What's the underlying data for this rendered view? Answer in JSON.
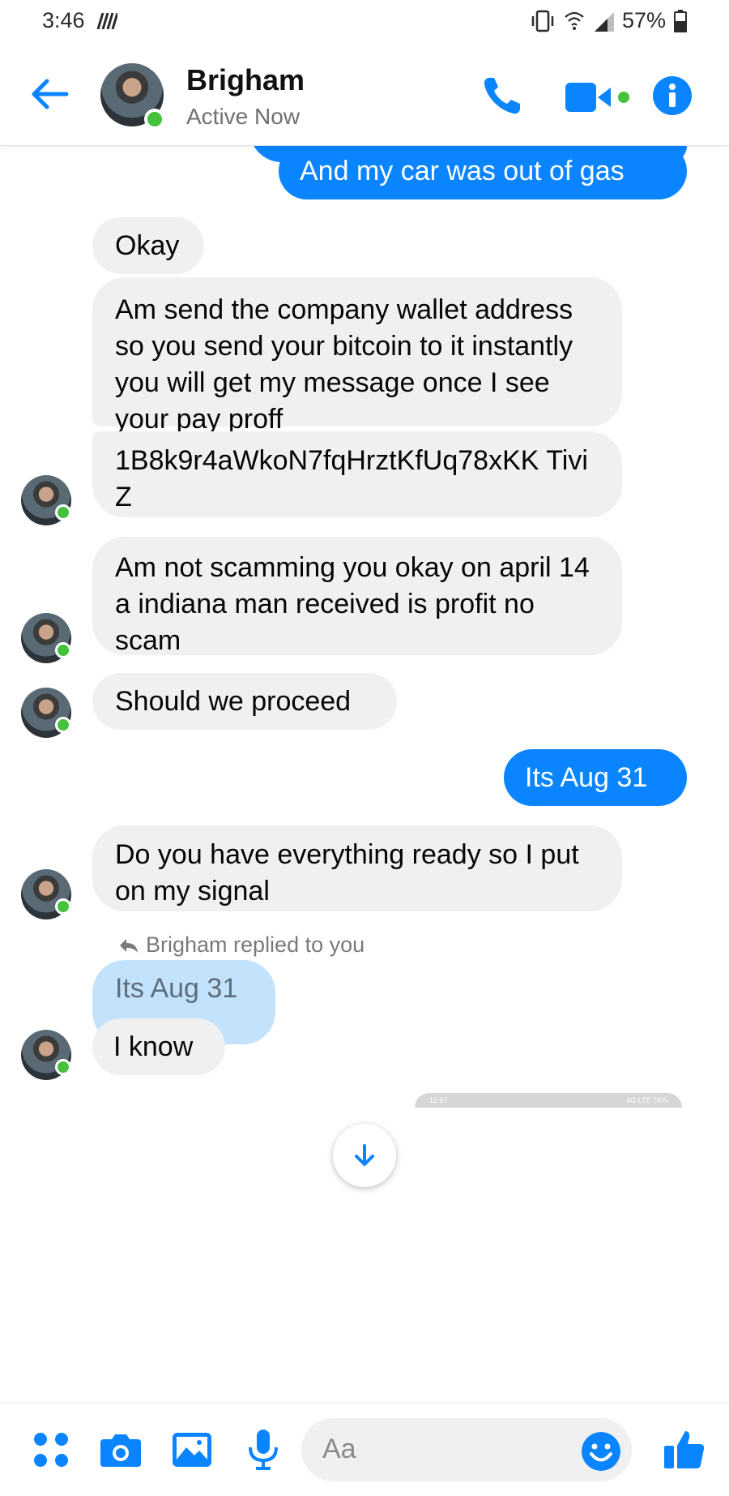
{
  "status_bar": {
    "time": "3:46",
    "battery": "57%"
  },
  "header": {
    "name": "Brigham",
    "status": "Active Now"
  },
  "messages": [
    {
      "side": "out",
      "text": "And my car was out of gas"
    },
    {
      "side": "in",
      "text": "Okay"
    },
    {
      "side": "in",
      "text": "Am send the company wallet address so you send your bitcoin to it instantly you will get my message once I see your pay proff"
    },
    {
      "side": "in",
      "text": "1B8k9r4aWkoN7fqHrztKfUq78xKK TiviZ"
    },
    {
      "side": "in",
      "text": "Am not scamming you okay on april 14 a indiana man received is profit no scam"
    },
    {
      "side": "in",
      "text": "Should we proceed"
    },
    {
      "side": "out",
      "text": "Its Aug 31"
    },
    {
      "side": "in",
      "text": "Do you have everything ready so I put on my signal"
    },
    {
      "side": "in",
      "text": "I know"
    }
  ],
  "reply": {
    "note": "Brigham replied to you",
    "quoted": "Its Aug 31"
  },
  "thumbnail_strip": {
    "time": "12:57",
    "status": "4G LTE 76%"
  },
  "composer": {
    "placeholder": "Aa"
  },
  "colors": {
    "accent": "#0a84ff",
    "incoming": "#f0f0f0",
    "online": "#44c23c",
    "quoted": "#c3e2fb"
  },
  "icons": [
    "back-arrow-icon",
    "phone-icon",
    "video-camera-icon",
    "info-icon",
    "scroll-down-icon",
    "apps-icon",
    "camera-icon",
    "gallery-icon",
    "microphone-icon",
    "emoji-icon",
    "thumbs-up-icon"
  ]
}
